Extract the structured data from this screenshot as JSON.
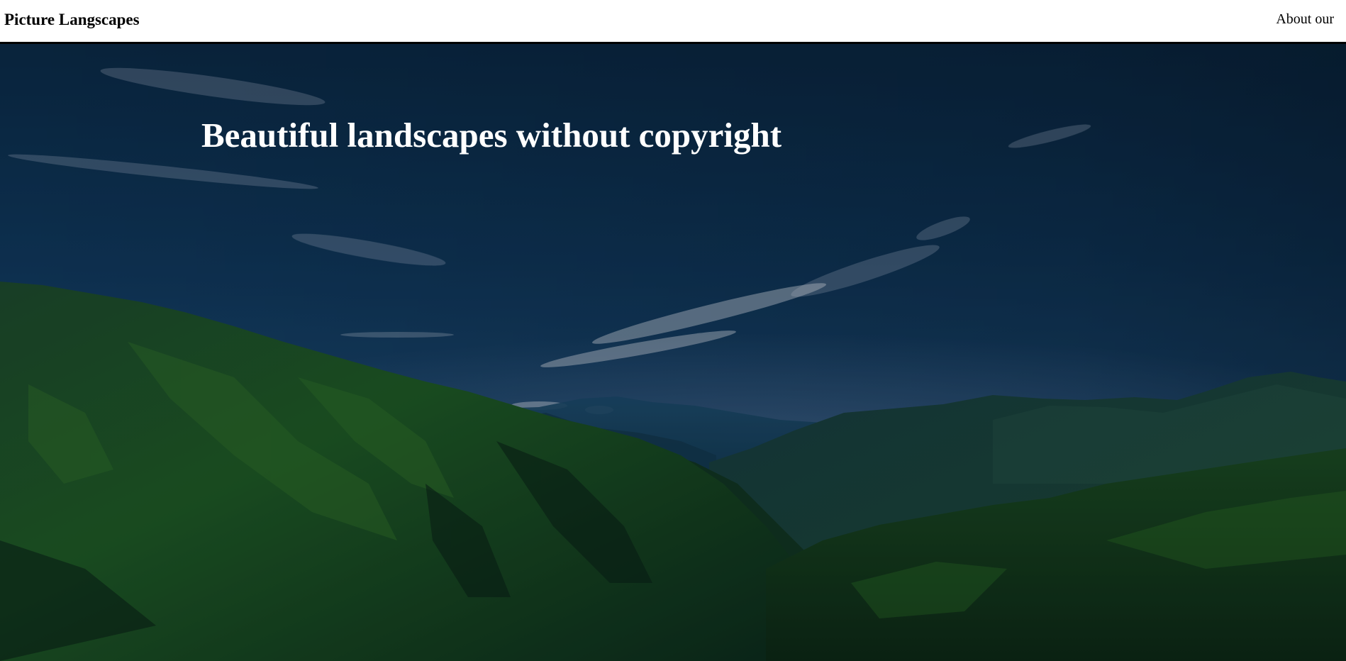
{
  "header": {
    "brand": "Picture Langscapes",
    "nav_link": "About our"
  },
  "hero": {
    "title": "Beautiful landscapes without copyright",
    "image": "mountain-valley-landscape"
  }
}
